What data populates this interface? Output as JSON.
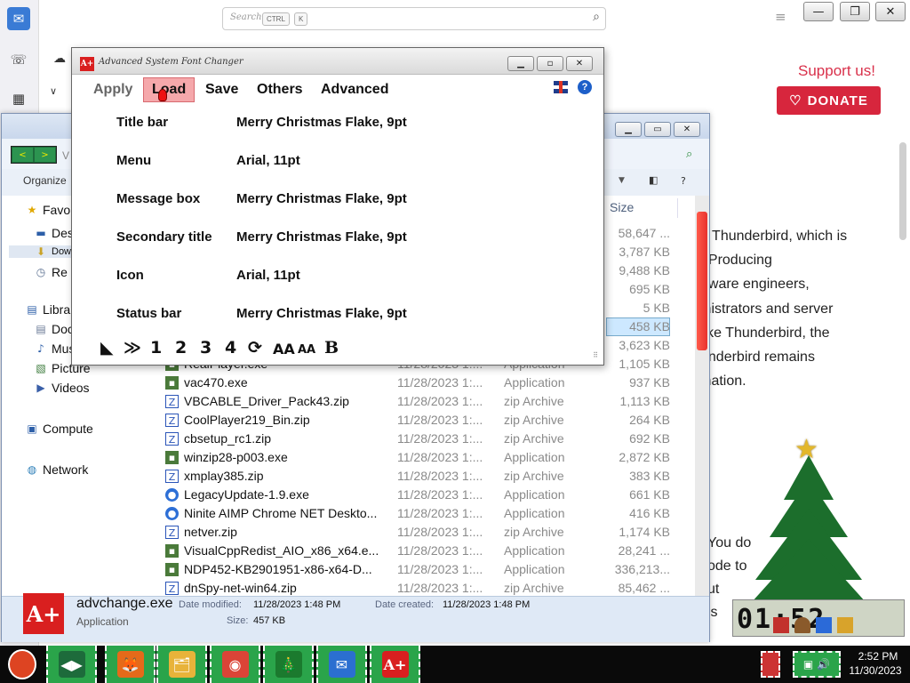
{
  "thunderbird": {
    "search_placeholder": "Search...",
    "kbd_ctrl": "CTRL",
    "kbd_k": "K",
    "support": "Support us!",
    "donate": "DONATE",
    "article_lines": [
      "g Thunderbird, which is",
      "! Producing",
      "ftware engineers,",
      "inistrators and server",
      "like Thunderbird, the",
      "underbird remains",
      "ination."
    ],
    "article2_lines": [
      "You do",
      "ode to",
      "ut",
      "is"
    ]
  },
  "explorer": {
    "nav_back": "<",
    "nav_fwd": ">",
    "address_fragment": "V",
    "organize": "Organize",
    "size_header": "Size",
    "nav_items": [
      {
        "label": "Favo",
        "icon": "star-icon"
      },
      {
        "label": "Des",
        "icon": "desktop-icon"
      },
      {
        "label": "Dow",
        "icon": "downloads-icon"
      },
      {
        "label": "Re",
        "icon": "recent-places-icon"
      },
      {
        "label": "Libra",
        "icon": "libraries-icon"
      },
      {
        "label": "Doc",
        "icon": "documents-icon"
      },
      {
        "label": "Mus",
        "icon": "music-icon"
      },
      {
        "label": "Picture",
        "icon": "pictures-icon"
      },
      {
        "label": "Videos",
        "icon": "videos-icon"
      },
      {
        "label": "Compute",
        "icon": "computer-icon"
      },
      {
        "label": "Network",
        "icon": "network-icon"
      }
    ],
    "sizes_top": [
      "58,647 ...",
      "3,787 KB",
      "9,488 KB",
      "695 KB",
      "5 KB",
      "458 KB",
      "3,623 KB"
    ],
    "files": [
      {
        "name": "RealPlayer.exe",
        "date": "11/28/2023 1:...",
        "type": "Application",
        "size": "1,105 KB",
        "kind": "exe"
      },
      {
        "name": "vac470.exe",
        "date": "11/28/2023 1:...",
        "type": "Application",
        "size": "937 KB",
        "kind": "exe"
      },
      {
        "name": "VBCABLE_Driver_Pack43.zip",
        "date": "11/28/2023 1:...",
        "type": "zip Archive",
        "size": "1,113 KB",
        "kind": "zip"
      },
      {
        "name": "CoolPlayer219_Bin.zip",
        "date": "11/28/2023 1:...",
        "type": "zip Archive",
        "size": "264 KB",
        "kind": "zip"
      },
      {
        "name": "cbsetup_rc1.zip",
        "date": "11/28/2023 1:...",
        "type": "zip Archive",
        "size": "692 KB",
        "kind": "zip"
      },
      {
        "name": "winzip28-p003.exe",
        "date": "11/28/2023 1:...",
        "type": "Application",
        "size": "2,872 KB",
        "kind": "exe"
      },
      {
        "name": "xmplay385.zip",
        "date": "11/28/2023 1:...",
        "type": "zip Archive",
        "size": "383 KB",
        "kind": "zip"
      },
      {
        "name": "LegacyUpdate-1.9.exe",
        "date": "11/28/2023 1:...",
        "type": "Application",
        "size": "661 KB",
        "kind": "app"
      },
      {
        "name": "Ninite AIMP Chrome NET Deskto...",
        "date": "11/28/2023 1:...",
        "type": "Application",
        "size": "416 KB",
        "kind": "app"
      },
      {
        "name": "netver.zip",
        "date": "11/28/2023 1:...",
        "type": "zip Archive",
        "size": "1,174 KB",
        "kind": "zip"
      },
      {
        "name": "VisualCppRedist_AIO_x86_x64.e...",
        "date": "11/28/2023 1:...",
        "type": "Application",
        "size": "28,241 ...",
        "kind": "exe"
      },
      {
        "name": "NDP452-KB2901951-x86-x64-D...",
        "date": "11/28/2023 1:...",
        "type": "Application",
        "size": "336,213...",
        "kind": "exe"
      },
      {
        "name": "dnSpy-net-win64.zip",
        "date": "11/28/2023 1:...",
        "type": "zip Archive",
        "size": "85,462 ...",
        "kind": "zip"
      }
    ],
    "details": {
      "icon_text": "A+",
      "filename": "advchange.exe",
      "filetype": "Application",
      "date_modified_label": "Date modified:",
      "date_modified": "11/28/2023 1:48 PM",
      "date_created_label": "Date created:",
      "date_created": "11/28/2023 1:48 PM",
      "size_label": "Size:",
      "size": "457 KB"
    }
  },
  "fontchanger": {
    "title": "Advanced System Font Changer",
    "app_icon_text": "A+",
    "menu": {
      "apply": "Apply",
      "load": "Load",
      "save": "Save",
      "others": "Others",
      "advanced": "Advanced"
    },
    "help": "?",
    "rows": [
      {
        "label": "Title bar",
        "value": "Merry Christmas Flake, 9pt"
      },
      {
        "label": "Menu",
        "value": "Arial, 11pt"
      },
      {
        "label": "Message box",
        "value": "Merry Christmas Flake, 9pt"
      },
      {
        "label": "Secondary title",
        "value": "Merry Christmas Flake, 9pt"
      },
      {
        "label": "Icon",
        "value": "Arial, 11pt"
      },
      {
        "label": "Status bar",
        "value": "Merry Christmas Flake, 9pt"
      }
    ],
    "tools": [
      "◣",
      "≫",
      "1",
      "2",
      "3",
      "4",
      "⟳",
      "AA",
      "AA",
      "B"
    ]
  },
  "desktop_clock": {
    "digits": "01:52"
  },
  "taskbar": {
    "clock_time": "2:52 PM",
    "clock_date": "11/30/2023",
    "pinned": [
      {
        "name": "explorer-nav-arrows",
        "glyph": "◀▶",
        "color": "#1d6b3b"
      },
      {
        "name": "firefox-icon",
        "glyph": "🦊",
        "color": "#e56a1a"
      },
      {
        "name": "file-explorer-icon",
        "glyph": "🗂",
        "color": "#e8b33a"
      },
      {
        "name": "chrome-icon",
        "glyph": "◉",
        "color": "#db4437"
      },
      {
        "name": "christmas-tree-icon",
        "glyph": "🎄",
        "color": "#1b7a2e"
      },
      {
        "name": "thunderbird-icon",
        "glyph": "✉",
        "color": "#2b6fd0"
      },
      {
        "name": "font-changer-icon",
        "glyph": "A+",
        "color": "#d91f1f"
      }
    ]
  }
}
